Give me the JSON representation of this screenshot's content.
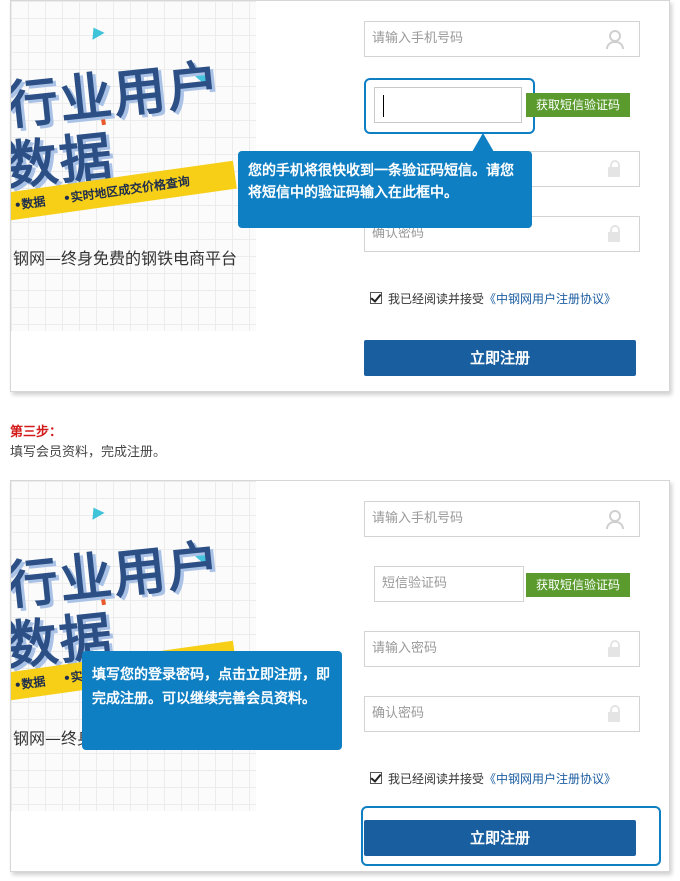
{
  "panel1": {
    "banner": {
      "headline1": "行业用户",
      "headline2": "数据",
      "stripe_item1": "•数据",
      "stripe_item2": "•实时地区成交价格查询",
      "tagline": "钢网—终身免费的钢铁电商平台"
    },
    "phone_placeholder": "请输入手机号码",
    "sms_button": "获取短信验证码",
    "tooltip": "您的手机将很快收到一条验证码短信。请您将短信中的验证码输入在此框中。",
    "confirm_placeholder": "确认密码",
    "agree_text": "我已经阅读并接受",
    "agree_link": "《中钢网用户注册协议》",
    "register_button": "立即注册"
  },
  "step3": {
    "title": "第三步：",
    "desc": "填写会员资料，完成注册。"
  },
  "panel2": {
    "banner": {
      "headline1": "行业用户",
      "headline2": "数据",
      "stripe_item1": "•数据",
      "stripe_item2": "•实",
      "tagline": "钢网—终身"
    },
    "phone_placeholder": "请输入手机号码",
    "sms_placeholder": "短信验证码",
    "sms_button": "获取短信验证码",
    "password_placeholder": "请输入密码",
    "confirm_placeholder": "确认密码",
    "tooltip": "填写您的登录密码，点击立即注册，即完成注册。可以继续完善会员资料。",
    "agree_text": "我已经阅读并接受",
    "agree_link": "《中钢网用户注册协议》",
    "register_button": "立即注册"
  },
  "colors": {
    "accent_blue": "#0f7fc3",
    "register_button": "#195f9f",
    "sms_button": "#5b9b2e",
    "step_title": "#d41b1b",
    "stripe": "#f6cf16"
  }
}
